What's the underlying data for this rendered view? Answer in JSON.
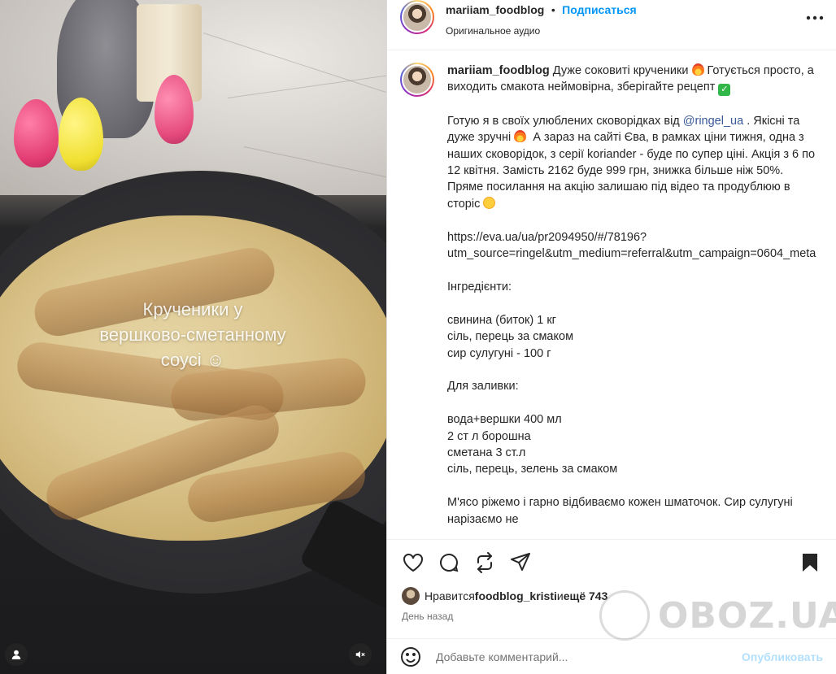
{
  "media": {
    "overlay_text": "Крученики у\nвершково-сметанному\nсоусі ☺"
  },
  "header": {
    "username": "mariiam_foodblog",
    "separator": "•",
    "follow_label": "Подписаться",
    "audio_label": "Оригинальное аудио"
  },
  "caption": {
    "username": "mariiam_foodblog",
    "intro": " Дуже соковиті крученики ",
    "intro2": " Готується просто, а виходить смакота неймовірна, зберігайте рецепт ",
    "p1_a": "\n\nГотую я в своїх улюблених сковорідках від ",
    "mention": "@ringel_ua",
    "p1_b": " . Якісні та дуже зручні ",
    "p1_c": "  А зараз на сайті Єва, в рамках ціни тижня, одна з наших сковорідок, з серії koriander - буде по супер ціні. Акція з 6 по 12 квітня. Замість 2162 буде 999 грн, знижка більше ніж 50%. Пряме посилання на акцію залишаю під відео та продублюю в сторіс ",
    "p2": "\n\nhttps://eva.ua/ua/pr2094950/#/78196?utm_source=ringel&utm_medium=referral&utm_campaign=0604_meta\n\nІнгредієнти:\n\nсвинина (биток) 1 кг\nсіль, перець за смаком\nсир сулугуні - 100 г\n\nДля заливки:\n\nвода+вершки 400 мл\n2 ст л борошна\nсметана 3 ст.л\nсіль, перець, зелень за смаком\n\nМ'ясо ріжемо і гарно відбиваємо кожен шматочок. Сир сулугуні нарізаємо не"
  },
  "likes": {
    "prefix": "Нравится ",
    "user": "foodblog_kristi",
    "middle": " и ",
    "more": "ещё 743"
  },
  "time_label": "День назад",
  "comment": {
    "placeholder": "Добавьте комментарий...",
    "post_label": "Опубликовать"
  },
  "watermark": "OBOZ.UA",
  "icons": {
    "more": "more-horizontal-icon",
    "like": "heart-icon",
    "comment": "comment-icon",
    "share": "repost-icon",
    "send": "send-icon",
    "save": "bookmark-icon",
    "emoji": "smile-icon",
    "user": "user-icon",
    "mute": "mute-icon"
  },
  "colors": {
    "link": "#0095f6",
    "mention": "#385898",
    "post_disabled": "#b2dffc",
    "secondary_text": "#737373"
  }
}
